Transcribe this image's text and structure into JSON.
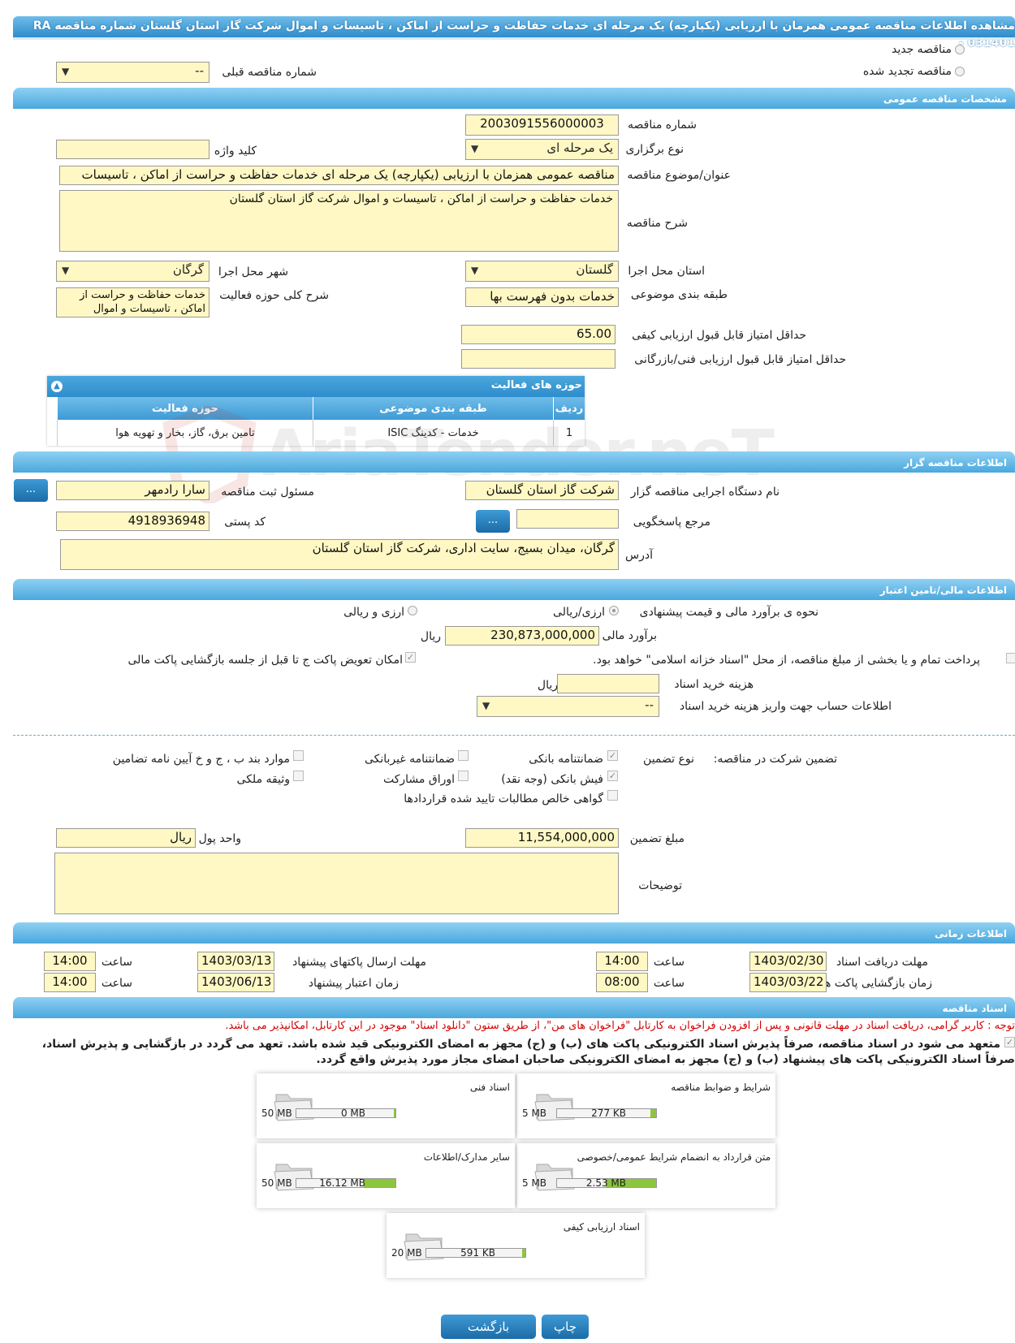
{
  "header": {
    "title": "مشاهده اطلاعات مناقصه عمومی همزمان با ارزیابی (یکپارچه) یک مرحله ای خدمات حفاظت و حراست از اماکن ، تاسیسات و اموال شرکت گاز استان گلستان شماره مناقصه RA 031401 -"
  },
  "tender_type": {
    "new": "مناقصه جدید",
    "renewed": "مناقصه تجدید شده",
    "prev_number_label": "شماره مناقصه قبلی",
    "prev_number_value": "--"
  },
  "sections": {
    "general": "مشخصات مناقصه عمومی",
    "organizer": "اطلاعات مناقصه گزار",
    "financial": "اطلاعات مالی/تامین اعتبار",
    "timing": "اطلاعات زمانی",
    "documents": "اسناد مناقصه"
  },
  "general": {
    "number_label": "شماره مناقصه",
    "number_value": "2003091556000003",
    "type_label": "نوع برگزاری",
    "type_value": "یک مرحله ای",
    "keyword_label": "کلید واژه",
    "keyword_value": "",
    "subject_label": "عنوان/موضوع مناقصه",
    "subject_value": "مناقصه عمومی همزمان با ارزیابی (یکپارچه) یک مرحله ای خدمات حفاظت و حراست از اماکن ، تاسیسات",
    "desc_label": "شرح مناقصه",
    "desc_value": "خدمات حفاظت و حراست از اماکن ، تاسیسات و اموال شرکت گاز استان گلستان",
    "province_label": "استان محل اجرا",
    "province_value": "گلستان",
    "city_label": "شهر محل اجرا",
    "city_value": "گرگان",
    "category_label": "طبقه بندی موضوعی",
    "category_value": "خدمات بدون فهرست بها",
    "activity_desc_label": "شرح کلی حوزه فعالیت",
    "activity_desc_value": "خدمات حفاظت و حراست از اماکن ، تاسیسات و اموال",
    "min_quality_label": "حداقل امتیاز قابل قبول ارزیابی کیفی",
    "min_quality_value": "65.00",
    "min_tech_label": "حداقل امتیاز قابل قبول ارزیابی فنی/بازرگانی",
    "min_tech_value": ""
  },
  "activity_panel": {
    "title": "حوزه های فعالیت",
    "headers": [
      "ردیف",
      "طبقه بندی موضوعی",
      "حوزه فعالیت"
    ],
    "rows": [
      {
        "idx": "1",
        "category": "خدمات - کدینگ ISIC",
        "field": "تامین برق، گاز، بخار و تهویه هوا"
      }
    ]
  },
  "watermark": "AriaTender.neT",
  "organizer": {
    "org_label": "نام دستگاه اجرایی مناقصه گزار",
    "org_value": "شرکت گاز استان گلستان",
    "registrar_label": "مسئول ثبت مناقصه",
    "registrar_value": "سارا رادمهر",
    "ref_label": "مرجع پاسخگویی",
    "ref_value": "",
    "postal_label": "کد پستی",
    "postal_value": "4918936948",
    "address_label": "آدرس",
    "address_value": "گرگان، میدان بسیج، سایت اداری، شرکت گاز استان گلستان",
    "dots": "..."
  },
  "financial": {
    "method_label": "نحوه ی برآورد مالی و قیمت پیشنهادی",
    "opt_rial": "ارزی/ریالی",
    "opt_fx": "ارزی و ریالی",
    "estimate_label": "برآورد مالی",
    "estimate_value": "230,873,000,000",
    "currency": "ریال",
    "treasury_text": "پرداخت تمام و یا بخشی از مبلغ مناقصه، از محل \"اسناد خزانه اسلامی\" خواهد بود.",
    "swap_text": "امکان تعویض پاکت ج تا قبل از جلسه بازگشایی پاکت مالی",
    "doc_cost_label": "هزینه خرید اسناد",
    "doc_cost_value": "",
    "doc_cost_currency": "ریال",
    "account_label": "اطلاعات حساب جهت واریز هزینه خرید اسناد",
    "account_value": "--"
  },
  "guarantee": {
    "title": "تضمین شرکت در مناقصه:",
    "type_label": "نوع تضمین",
    "options": {
      "bank_guarantee": "ضمانتنامه بانکی",
      "non_bank_guarantee": "ضمانتنامه غیربانکی",
      "clauses": "موارد بند ب ، ج و خ آیین نامه تضامین",
      "bank_receipt": "فیش بانکی (وجه نقد)",
      "bonds": "اوراق مشارکت",
      "property": "وثیقه ملکی",
      "receivables": "گواهی خالص مطالبات تایید شده قراردادها"
    },
    "amount_label": "مبلغ تضمین",
    "amount_value": "11,554,000,000",
    "unit_label": "واحد پول",
    "unit_value": "ریال",
    "notes_label": "توضیحات",
    "notes_value": ""
  },
  "timing": {
    "doc_receive_label": "مهلت دریافت اسناد",
    "doc_receive_date": "1403/02/30",
    "doc_receive_time": "14:00",
    "send_label": "مهلت ارسال پاکتهای پیشنهاد",
    "send_date": "1403/03/13",
    "send_time": "14:00",
    "open_label": "زمان بازگشایی پاکت ها",
    "open_date": "1403/03/22",
    "open_time": "08:00",
    "validity_label": "زمان اعتبار پیشنهاد",
    "validity_date": "1403/06/13",
    "validity_time": "14:00",
    "time_label": "ساعت"
  },
  "documents": {
    "notice": "توجه : کاربر گرامی، دریافت اسناد در مهلت قانونی و پس از افزودن فراخوان به کارتابل \"فراخوان های من\"، از طریق ستون \"دانلود اسناد\" موجود در این کارتابل، امکانپذیر می باشد.",
    "commit_line1": "متعهد می شود در اسناد مناقصه، صرفاً پذیرش اسناد الکترونیکی پاکت های (ب) و (ج) مجهز به امضای الکترونیکی قید شده باشد. تعهد می گردد در بازگشایی و پذیرش اسناد،",
    "commit_line2": "صرفاً اسناد الکترونیکی پاکت های پیشنهاد (ب) و (ج) مجهز به امضای الکترونیکی صاحبان امضای مجاز مورد پذیرش واقع گردد.",
    "files": [
      {
        "title": "شرایط و ضوابط مناقصه",
        "current": "277 KB",
        "max": "5 MB",
        "fraction": 0.054
      },
      {
        "title": "اسناد فنی",
        "current": "0 MB",
        "max": "50 MB",
        "fraction": 0.0
      },
      {
        "title": "متن قرارداد به انضمام شرایط عمومی/خصوصی",
        "current": "2.53 MB",
        "max": "5 MB",
        "fraction": 0.506
      },
      {
        "title": "سایر مدارک/اطلاعات",
        "current": "16.12 MB",
        "max": "50 MB",
        "fraction": 0.322
      },
      {
        "title": "اسناد ارزیابی کیفی",
        "current": "591 KB",
        "max": "20 MB",
        "fraction": 0.029
      }
    ]
  },
  "buttons": {
    "print": "چاپ",
    "back": "بازگشت"
  }
}
